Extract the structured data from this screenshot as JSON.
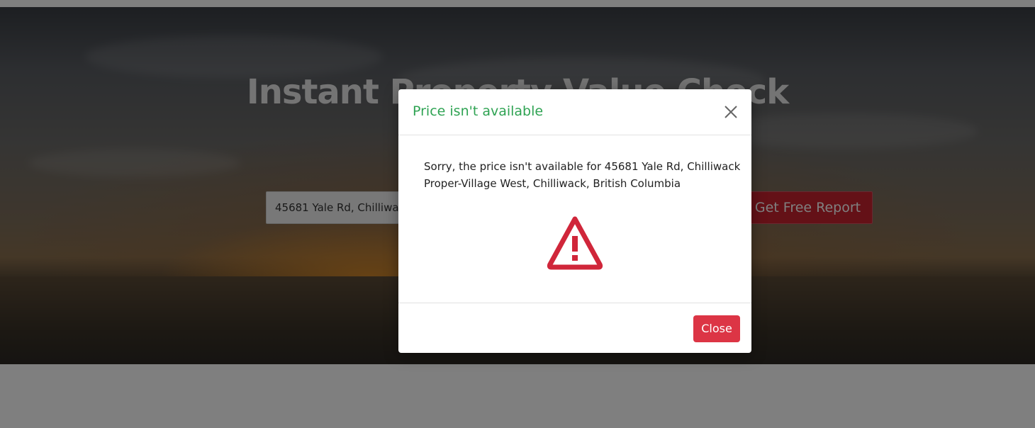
{
  "page": {
    "hero_title": "Instant Property Value Check",
    "address_value": "45681 Yale Rd, Chilliwack",
    "report_button": "Get Free Report"
  },
  "modal": {
    "title": "Price isn't available",
    "message": "Sorry, the price isn't available for 45681 Yale Rd, Chilliwack Proper-Village West, Chilliwack, British Columbia",
    "close_button": "Close",
    "close_icon": "close-icon",
    "warning_icon": "warning-icon"
  },
  "colors": {
    "title_green": "#2fa353",
    "danger_red": "#dc3545",
    "report_red": "#c9222f"
  }
}
